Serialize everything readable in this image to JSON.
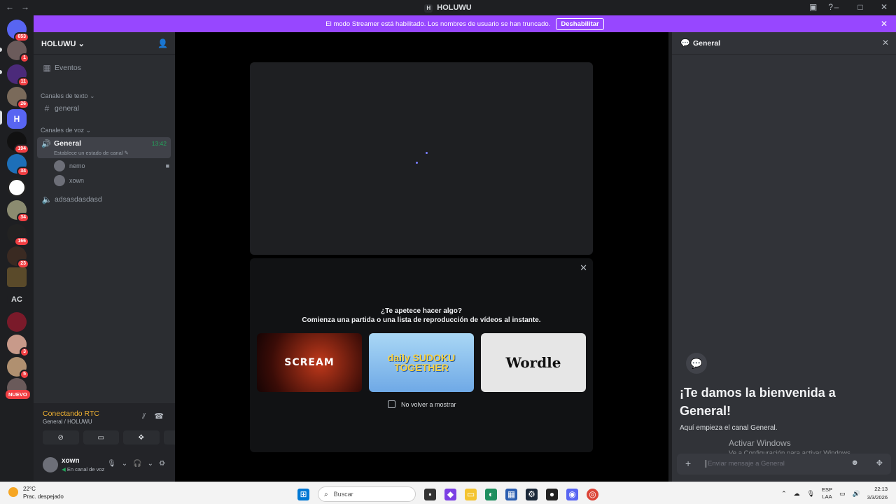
{
  "window": {
    "title": "HOLUWU",
    "server_initial": "H"
  },
  "banner": {
    "message": "El modo Streamer está habilitado. Los nombres de usuario se han truncado.",
    "button": "Deshabilitar"
  },
  "guilds": {
    "badges": [
      "653",
      "1",
      "11",
      "26",
      "194",
      "34",
      "34",
      "166",
      "23",
      "3",
      "5"
    ],
    "ac_label": "AC",
    "home_initial": "H",
    "new_label": "NUEVO"
  },
  "sidebar": {
    "server_name": "HOLUWU",
    "events": "Eventos",
    "text_category": "Canales de texto",
    "text_channel": "general",
    "voice_category": "Canales de voz",
    "voice_channel": {
      "name": "General",
      "time": "13:42",
      "status": "Establece un estado de canal"
    },
    "voice_users": [
      "nemo",
      "xown"
    ],
    "voice_channel_2": "adsasdasdasd"
  },
  "rtc": {
    "status": "Conectando RTC",
    "location": "General / HOLUWU"
  },
  "user": {
    "name": "xown",
    "status": "En canal de voz"
  },
  "activity": {
    "question": "¿Te apetece hacer algo?",
    "subtitle": "Comienza una partida o una lista de reproducción de vídeos al instante.",
    "games": [
      "SCREAM",
      "daily SUDOKU TOGETHER",
      "Wordle"
    ],
    "dont_show": "No volver a mostrar"
  },
  "panel": {
    "channel": "General",
    "welcome": "¡Te damos la bienvenida a General!",
    "begin": "Aquí empieza el canal General.",
    "placeholder": "Enviar mensaje a General"
  },
  "windows_activation": {
    "title": "Activar Windows",
    "sub": "Ve a Configuración para activar Windows."
  },
  "taskbar": {
    "temp": "22°C",
    "condition": "Prac. despejado",
    "search": "Buscar",
    "lang1": "ESP",
    "lang2": "LAA",
    "time": "22:13",
    "date": "3/3/2026"
  },
  "colors": {
    "accent": "#9747ff",
    "online": "#23a55a",
    "warning": "#f0b232",
    "danger": "#f23f43"
  }
}
